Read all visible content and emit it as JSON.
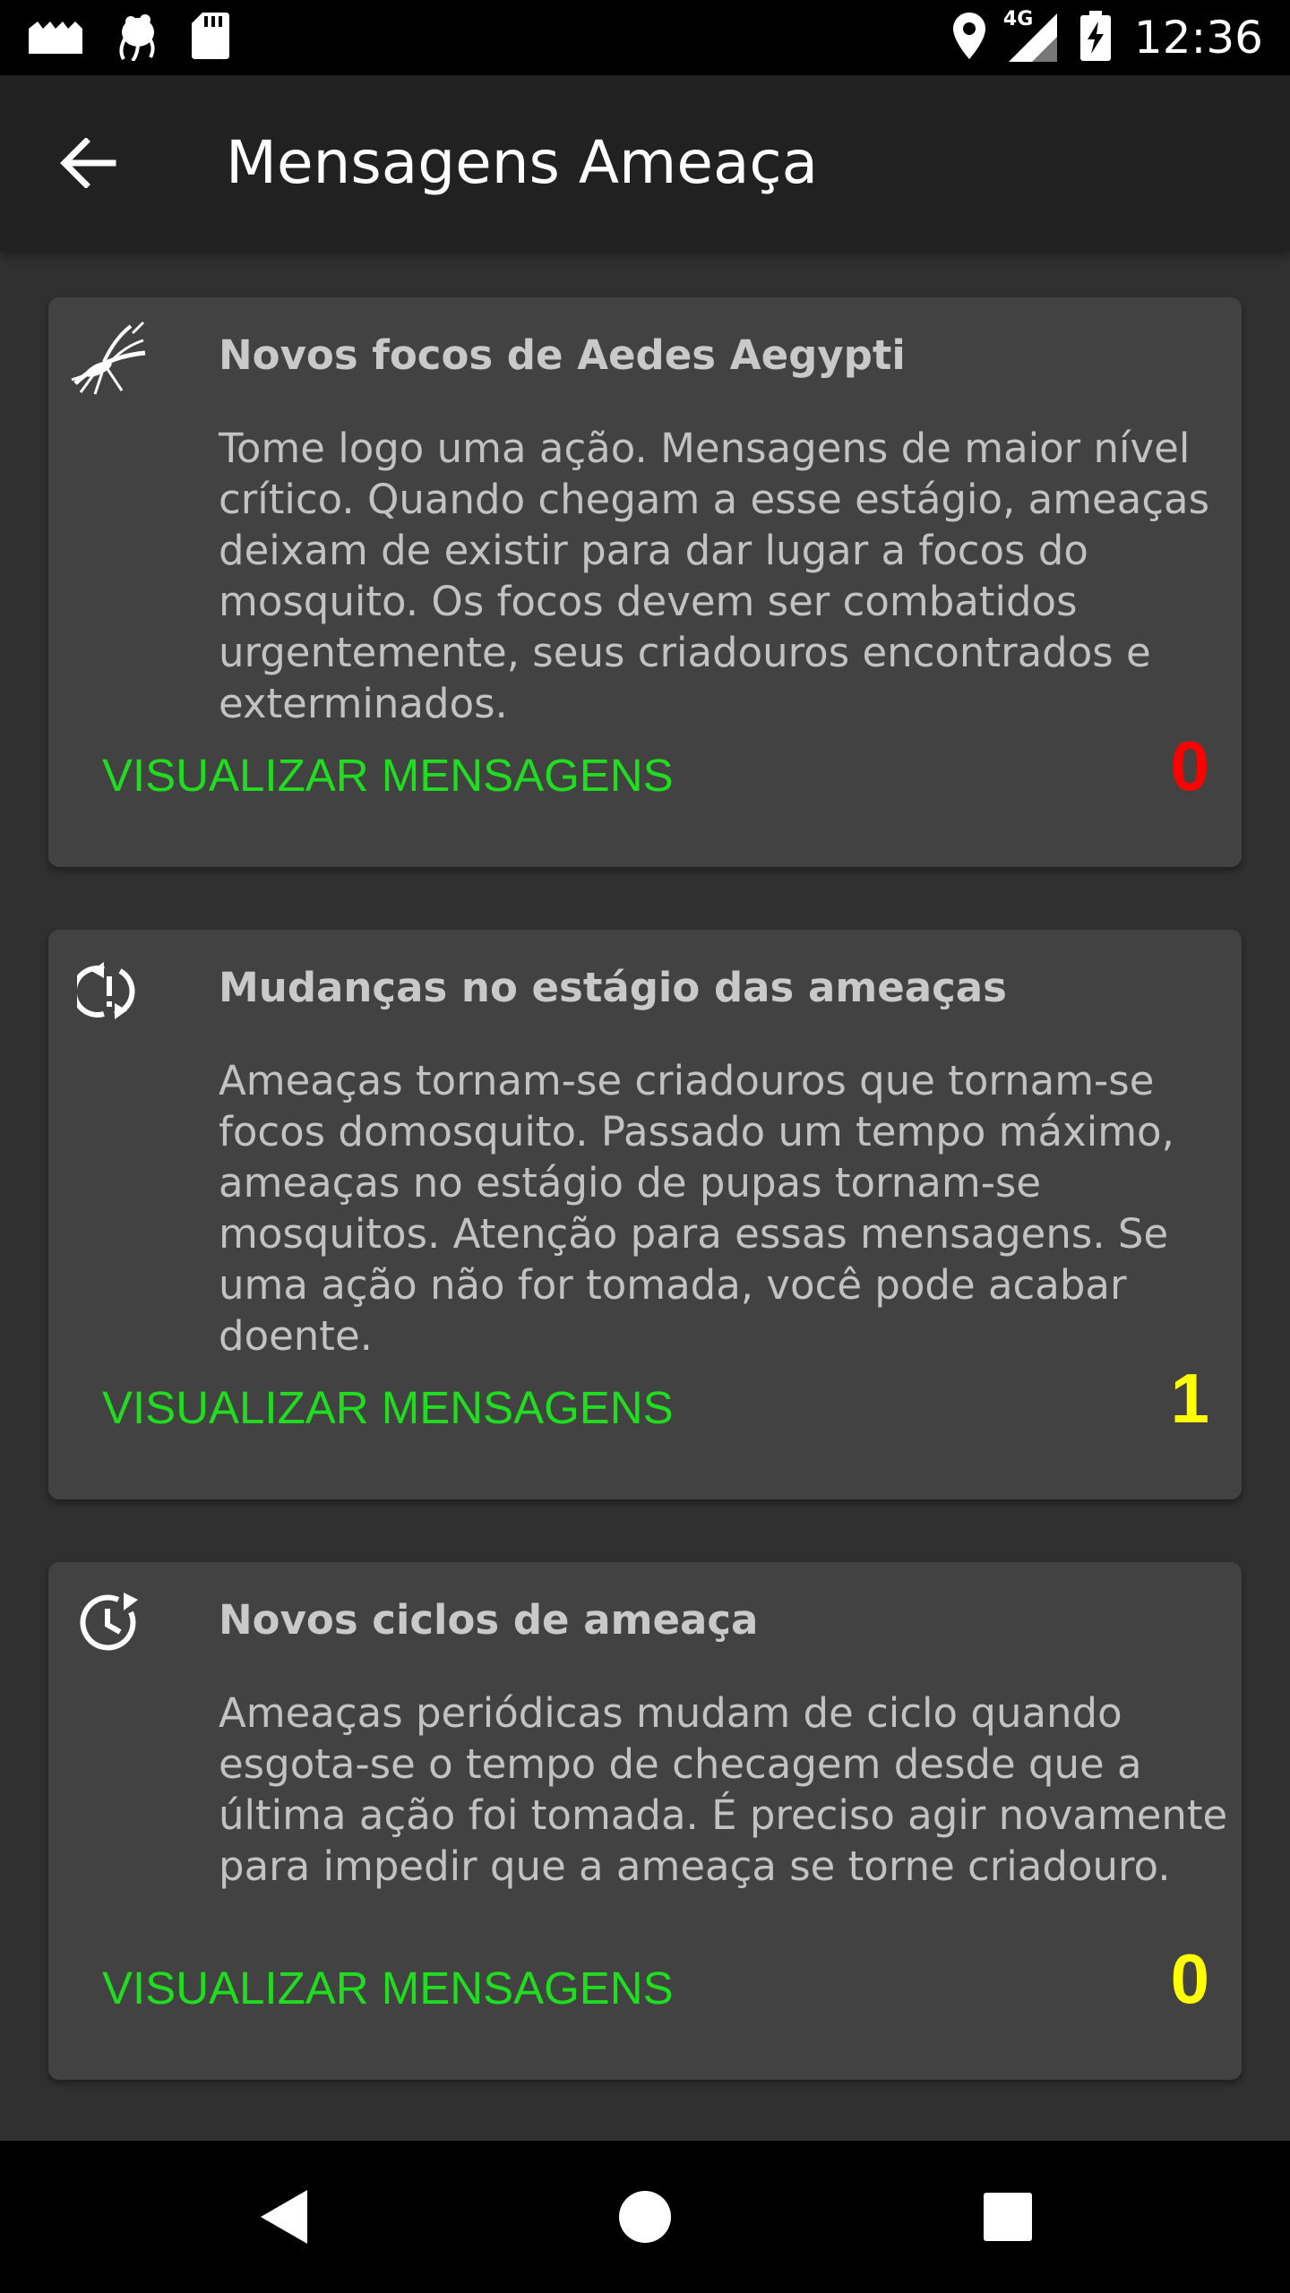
{
  "status_bar": {
    "time": "12:36",
    "network": "4G",
    "icons": [
      "photo-icon",
      "bug-icon",
      "sd-card-icon",
      "location-icon",
      "signal-icon",
      "battery-charging-icon"
    ]
  },
  "app_bar": {
    "title": "Mensagens Ameaça",
    "back_icon": "arrow-back-icon"
  },
  "cards": [
    {
      "icon": "mosquito-icon",
      "title": "Novos focos de Aedes Aegypti",
      "description": "Tome logo uma ação. Mensagens de maior nível crítico. Quando chegam a esse estágio, ameaças deixam de existir para dar lugar a focos do mosquito. Os focos devem ser combatidos urgentemente, seus criadouros encontrados e exterminados.",
      "action_label": "VISUALIZAR MENSAGENS",
      "count": "0",
      "count_color": "#ff0000"
    },
    {
      "icon": "alert-cycle-icon",
      "title": "Mudanças no estágio das ameaças",
      "description": "Ameaças tornam-se criadouros que tornam-se focos domosquito. Passado um tempo máximo, ameaças no estágio de pupas tornam-se mosquitos. Atenção para essas mensagens. Se uma ação não for tomada, você pode acabar doente.",
      "action_label": "VISUALIZAR MENSAGENS",
      "count": "1",
      "count_color": "#ffff00"
    },
    {
      "icon": "clock-refresh-icon",
      "title": "Novos ciclos de ameaça",
      "description": "Ameaças periódicas mudam de ciclo quando esgota-se o tempo de checagem desde que a última ação foi tomada. É preciso agir novamente para impedir que a ameaça se torne criadouro.",
      "action_label": "VISUALIZAR MENSAGENS",
      "count": "0",
      "count_color": "#ffff00"
    }
  ],
  "nav_bar": {
    "icons": [
      "nav-back-icon",
      "nav-home-icon",
      "nav-recents-icon"
    ]
  },
  "colors": {
    "action": "#20dd20",
    "card": "#424242",
    "background": "#303030",
    "app_bar": "#212121"
  }
}
